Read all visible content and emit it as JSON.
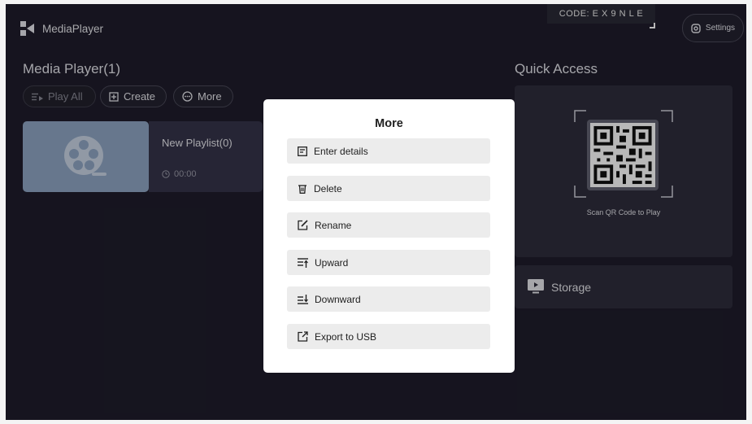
{
  "app": {
    "name": "MediaPlayer"
  },
  "header": {
    "code": "CODE: E X 9 N L E",
    "settings_label": "Settings"
  },
  "main": {
    "title": "Media Player(1)",
    "toolbar": {
      "play_all": "Play All",
      "create": "Create",
      "more": "More"
    },
    "playlist": {
      "name": "New Playlist(0)",
      "duration": "00:00"
    }
  },
  "quick_access": {
    "title": "Quick Access",
    "scan_text": "Scan QR Code to Play",
    "storage_label": "Storage"
  },
  "modal": {
    "title": "More",
    "items": [
      {
        "label": "Enter details",
        "icon": "details-icon"
      },
      {
        "label": "Delete",
        "icon": "trash-icon"
      },
      {
        "label": "Rename",
        "icon": "edit-icon"
      },
      {
        "label": "Upward",
        "icon": "move-up-icon"
      },
      {
        "label": "Downward",
        "icon": "move-down-icon"
      },
      {
        "label": "Export to USB",
        "icon": "export-icon"
      }
    ]
  },
  "colors": {
    "background": "#1f1d2b",
    "panel": "#2e2d3c",
    "thumbnail": "#8fa6c4",
    "modal": "#ffffff",
    "modal_item": "#ececec"
  }
}
